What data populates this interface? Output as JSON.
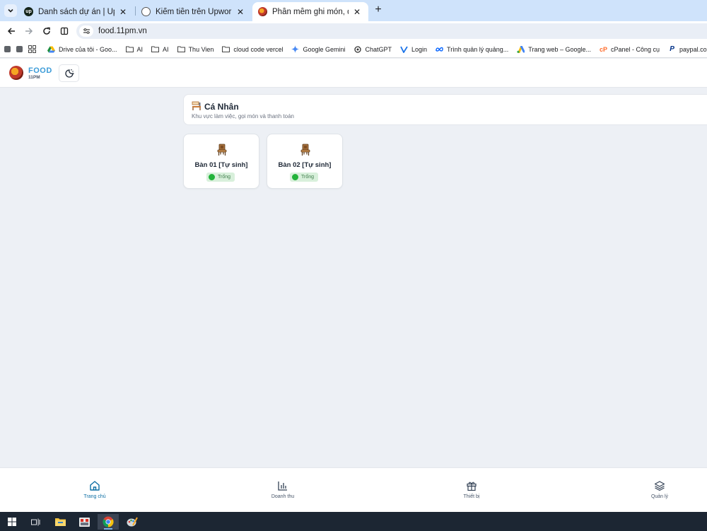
{
  "browser": {
    "tabs": [
      {
        "title": "Danh sách dự án | Upwork",
        "favicon": "upwork-icon",
        "active": false
      },
      {
        "title": "Kiếm tiền trên Upwork",
        "favicon": "openai-icon",
        "active": false
      },
      {
        "title": "Phần mềm ghi món, quản lý qu",
        "favicon": "food-logo-icon",
        "active": true
      }
    ],
    "url": "food.11pm.vn",
    "bookmarks": [
      {
        "label": "Drive của tôi - Goo...",
        "icon": "google-drive-icon"
      },
      {
        "label": "AI",
        "icon": "folder-icon"
      },
      {
        "label": "AI",
        "icon": "folder-icon"
      },
      {
        "label": "Thu Vien",
        "icon": "folder-icon"
      },
      {
        "label": "cloud code vercel",
        "icon": "folder-icon"
      },
      {
        "label": "Google Gemini",
        "icon": "gemini-icon"
      },
      {
        "label": "ChatGPT",
        "icon": "chatgpt-icon"
      },
      {
        "label": "Login",
        "icon": "login-icon"
      },
      {
        "label": "Trình quản lý quảng...",
        "icon": "meta-icon"
      },
      {
        "label": "Trang web – Google...",
        "icon": "google-ads-icon"
      },
      {
        "label": "cPanel - Công cụ",
        "icon": "cpanel-icon"
      },
      {
        "label": "paypal.com/signin?l...",
        "icon": "paypal-icon"
      }
    ]
  },
  "app": {
    "logo_title": "FOOD",
    "logo_subtitle": "11PM",
    "section": {
      "title": "Cá Nhân",
      "subtitle": "Khu vực làm việc, gọi món và thanh toán"
    },
    "tables": [
      {
        "name": "Bàn 01 [Tự sinh]",
        "status": "Trống"
      },
      {
        "name": "Bàn 02 [Tự sinh]",
        "status": "Trống"
      }
    ],
    "bottom_nav": [
      {
        "label": "Trang chủ",
        "icon": "home-icon",
        "active": true
      },
      {
        "label": "Doanh thu",
        "icon": "bar-chart-icon",
        "active": false
      },
      {
        "label": "Thiết bị",
        "icon": "gift-icon",
        "active": false
      },
      {
        "label": "Quản lý",
        "icon": "layers-icon",
        "active": false
      }
    ]
  },
  "colors": {
    "accent": "#0c6ea4",
    "logo_blue": "#3b9bd8",
    "status_green": "#22b33a",
    "page_bg": "#edf0f5"
  }
}
